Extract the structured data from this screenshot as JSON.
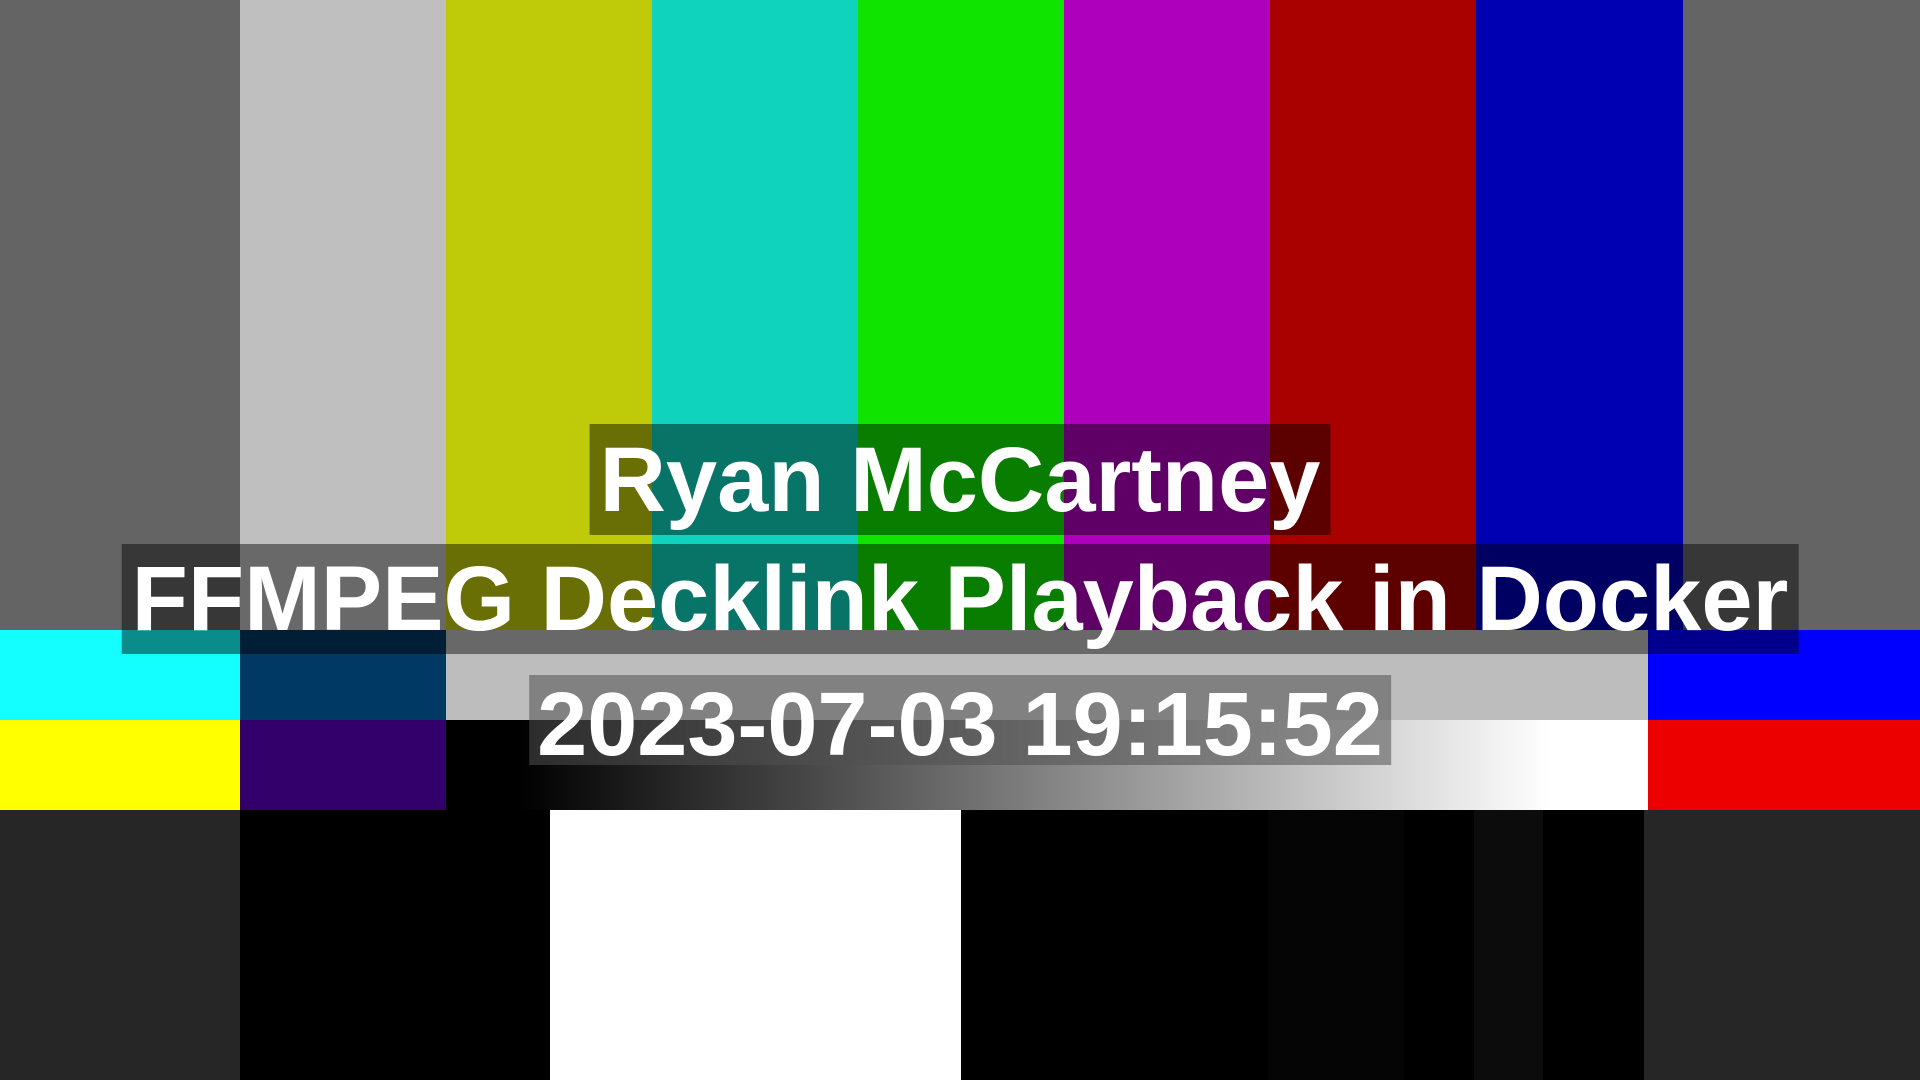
{
  "overlay": {
    "name": "Ryan McCartney",
    "description": "FFMPEG Decklink Playback in Docker",
    "timestamp": "2023-07-03 19:15:52"
  },
  "colors": {
    "main_bars": [
      "#646464",
      "#bfbfbf",
      "#bfca09",
      "#0fd3bd",
      "#0fe300",
      "#ae00bc",
      "#a90000",
      "#0000b3",
      "#646464"
    ],
    "mid1": [
      "#13ffff",
      "#003a64",
      "#bdbdbd",
      "#0000ff"
    ],
    "mid2": [
      "#ffff00",
      "#33006b",
      "#ed0000"
    ],
    "bottom": [
      "#262626",
      "#000000",
      "#ffffff",
      "#000000",
      "#050505",
      "#000000",
      "#0c0c0c",
      "#000000",
      "#262626"
    ]
  }
}
